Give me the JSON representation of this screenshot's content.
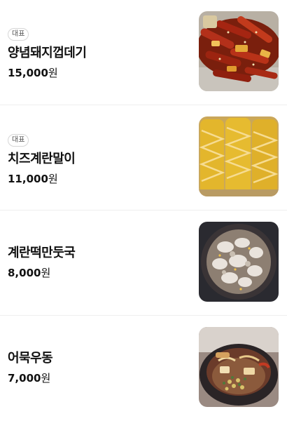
{
  "menu": {
    "items": [
      {
        "badge": "대표",
        "name": "양념돼지껍데기",
        "price": "15,000",
        "currency": "원",
        "image_icon": "spicy-pork-skin-photo"
      },
      {
        "badge": "대표",
        "name": "치즈계란말이",
        "price": "11,000",
        "currency": "원",
        "image_icon": "cheese-egg-roll-photo"
      },
      {
        "name": "계란떡만둣국",
        "price": "8,000",
        "currency": "원",
        "image_icon": "dumpling-soup-photo"
      },
      {
        "name": "어묵우동",
        "price": "7,000",
        "currency": "원",
        "image_icon": "fishcake-udon-photo"
      }
    ]
  }
}
